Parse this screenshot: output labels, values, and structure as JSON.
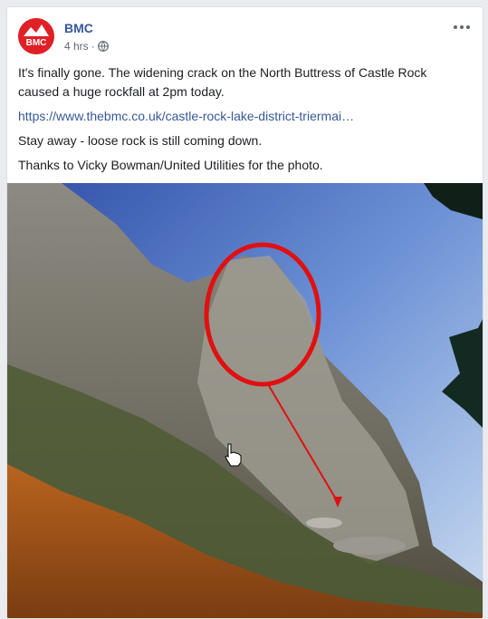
{
  "post": {
    "page_name": "BMC",
    "avatar_label": "BMC",
    "timestamp": "4 hrs",
    "privacy_icon": "globe-icon",
    "more_icon": "more-dots-icon",
    "paragraph_1": "It's finally gone. The widening crack on the North Buttress of Castle Rock caused a huge rockfall at 2pm today.",
    "link_text": "https://www.thebmc.co.uk/castle-rock-lake-district-triermai…",
    "paragraph_2": "Stay away - loose rock is still coming down.",
    "paragraph_3": "Thanks to Vicky Bowman/United Utilities for the photo."
  },
  "colors": {
    "brand_red": "#e02027",
    "link": "#385898",
    "name": "#365899",
    "annotation_red": "#e01010"
  }
}
